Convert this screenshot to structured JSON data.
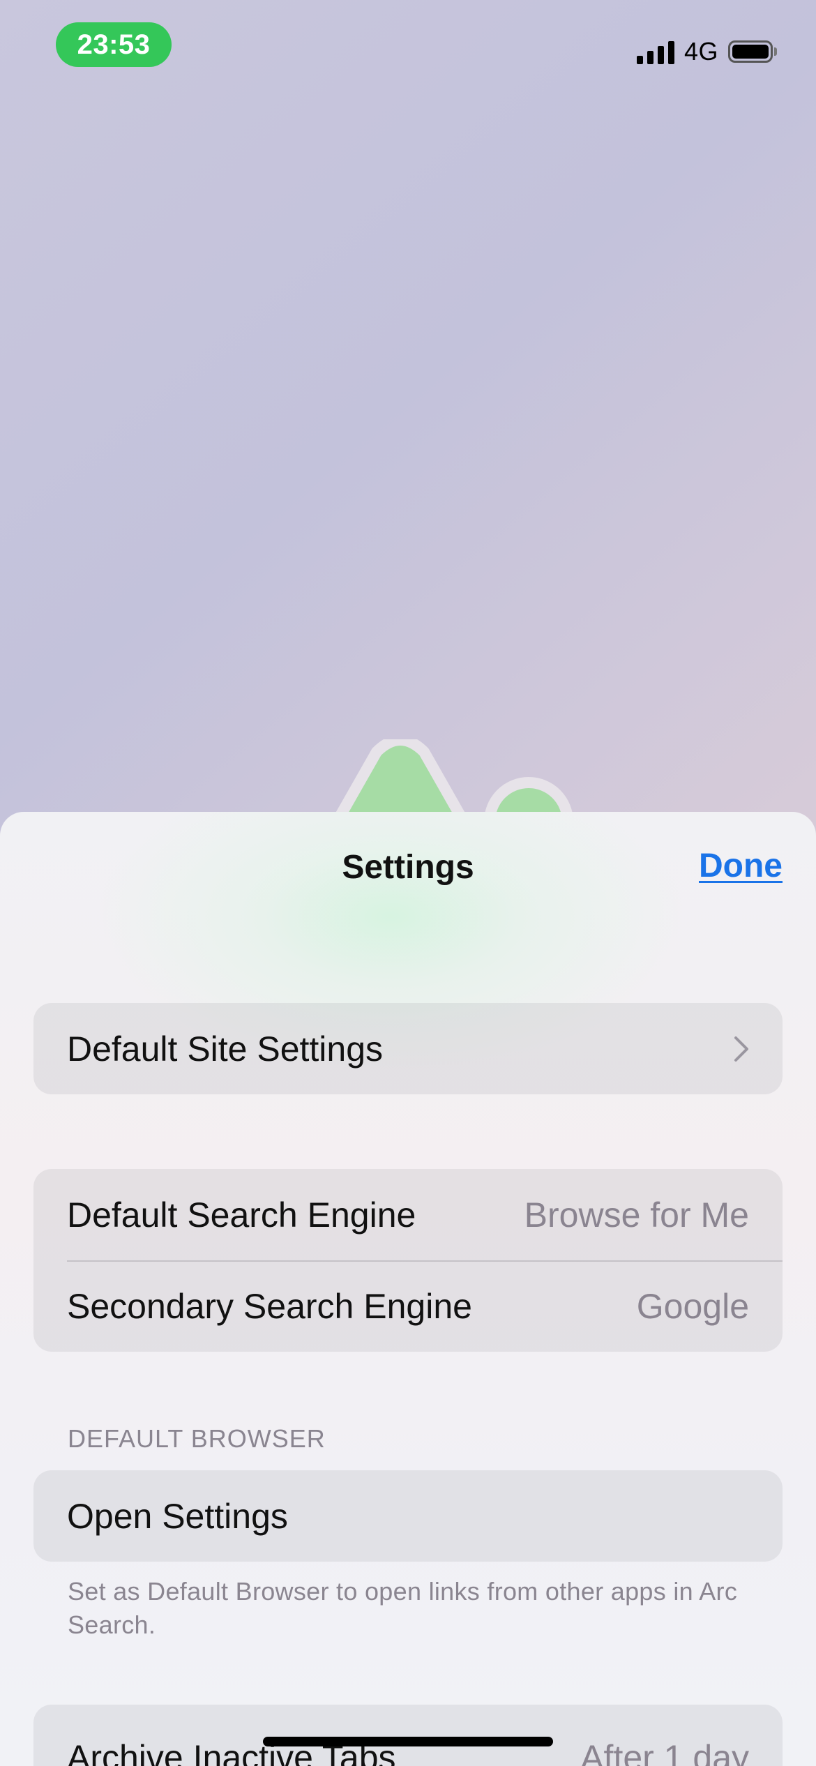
{
  "status_bar": {
    "time": "23:53",
    "network": "4G",
    "icons": [
      "signal-bars-icon",
      "battery-icon"
    ],
    "time_pill_color": "#34c759"
  },
  "sheet": {
    "title": "Settings",
    "done_label": "Done",
    "accent_color": "#1a73e8"
  },
  "groups": {
    "site": {
      "default_site_settings": "Default Site Settings"
    },
    "search": {
      "default_engine_label": "Default Search Engine",
      "default_engine_value": "Browse for Me",
      "secondary_engine_label": "Secondary Search Engine",
      "secondary_engine_value": "Google"
    },
    "default_browser": {
      "header": "DEFAULT BROWSER",
      "open_settings_label": "Open Settings",
      "footer": "Set as Default Browser to open links from other apps in Arc Search."
    },
    "archive": {
      "label": "Archive Inactive Tabs",
      "value": "After 1 day"
    }
  }
}
